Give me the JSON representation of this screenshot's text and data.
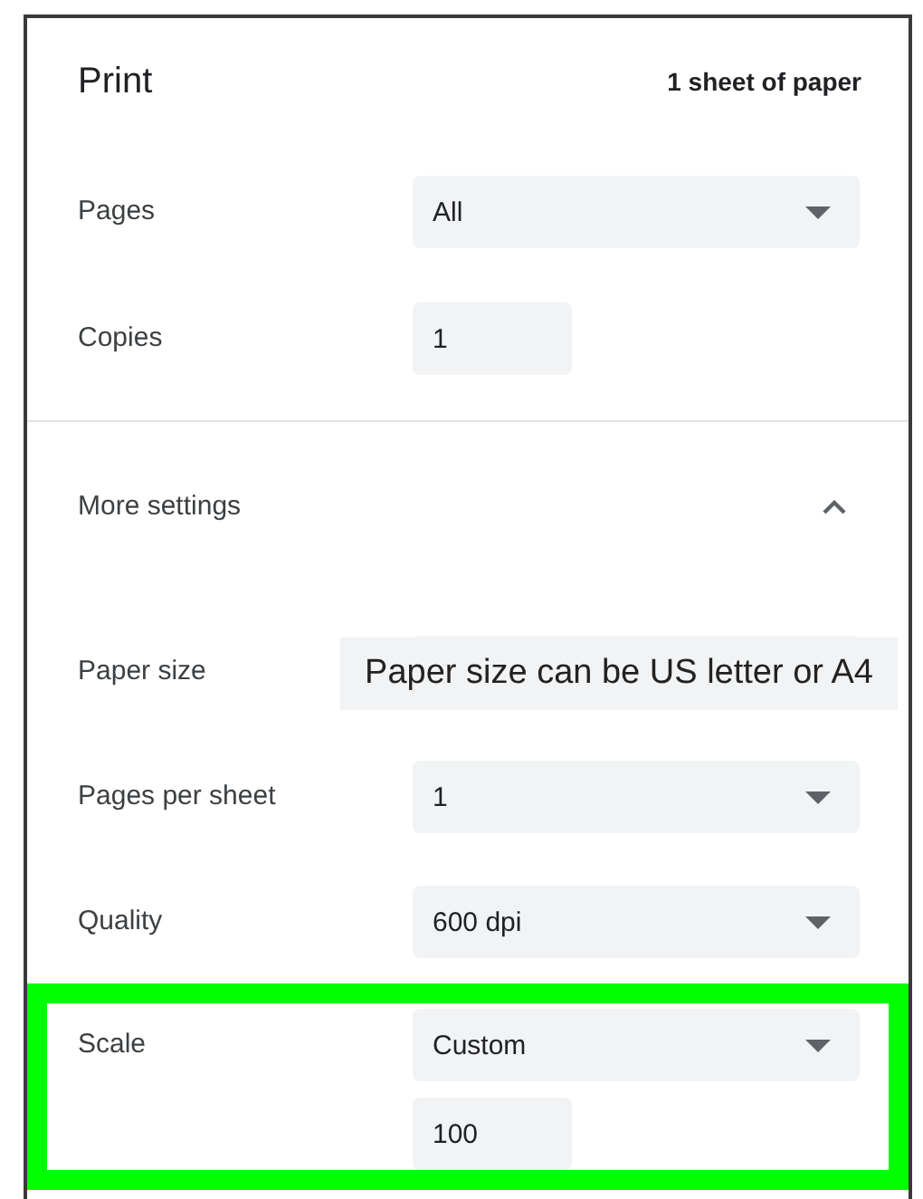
{
  "dialog": {
    "title": "Print",
    "summary": "1 sheet of paper",
    "settings": [
      {
        "label": "Pages",
        "controls": [
          {
            "kind": "select",
            "value": "All"
          }
        ]
      },
      {
        "label": "Copies",
        "controls": [
          {
            "kind": "number",
            "value": "1"
          }
        ]
      }
    ],
    "more_settings": {
      "label": "More settings",
      "expanded": true,
      "settings": [
        {
          "label": "Paper size",
          "highlighted": false,
          "callout": "Paper size can be US letter or A4",
          "controls": [
            {
              "kind": "select"
            }
          ]
        },
        {
          "label": "Pages per sheet",
          "highlighted": false,
          "controls": [
            {
              "kind": "select",
              "value": "1"
            }
          ]
        },
        {
          "label": "Quality",
          "highlighted": false,
          "controls": [
            {
              "kind": "select",
              "value": "600 dpi"
            }
          ]
        },
        {
          "label": "Scale",
          "highlighted": true,
          "controls": [
            {
              "kind": "select",
              "value": "Custom"
            },
            {
              "kind": "number",
              "value": "100"
            }
          ]
        }
      ]
    }
  }
}
